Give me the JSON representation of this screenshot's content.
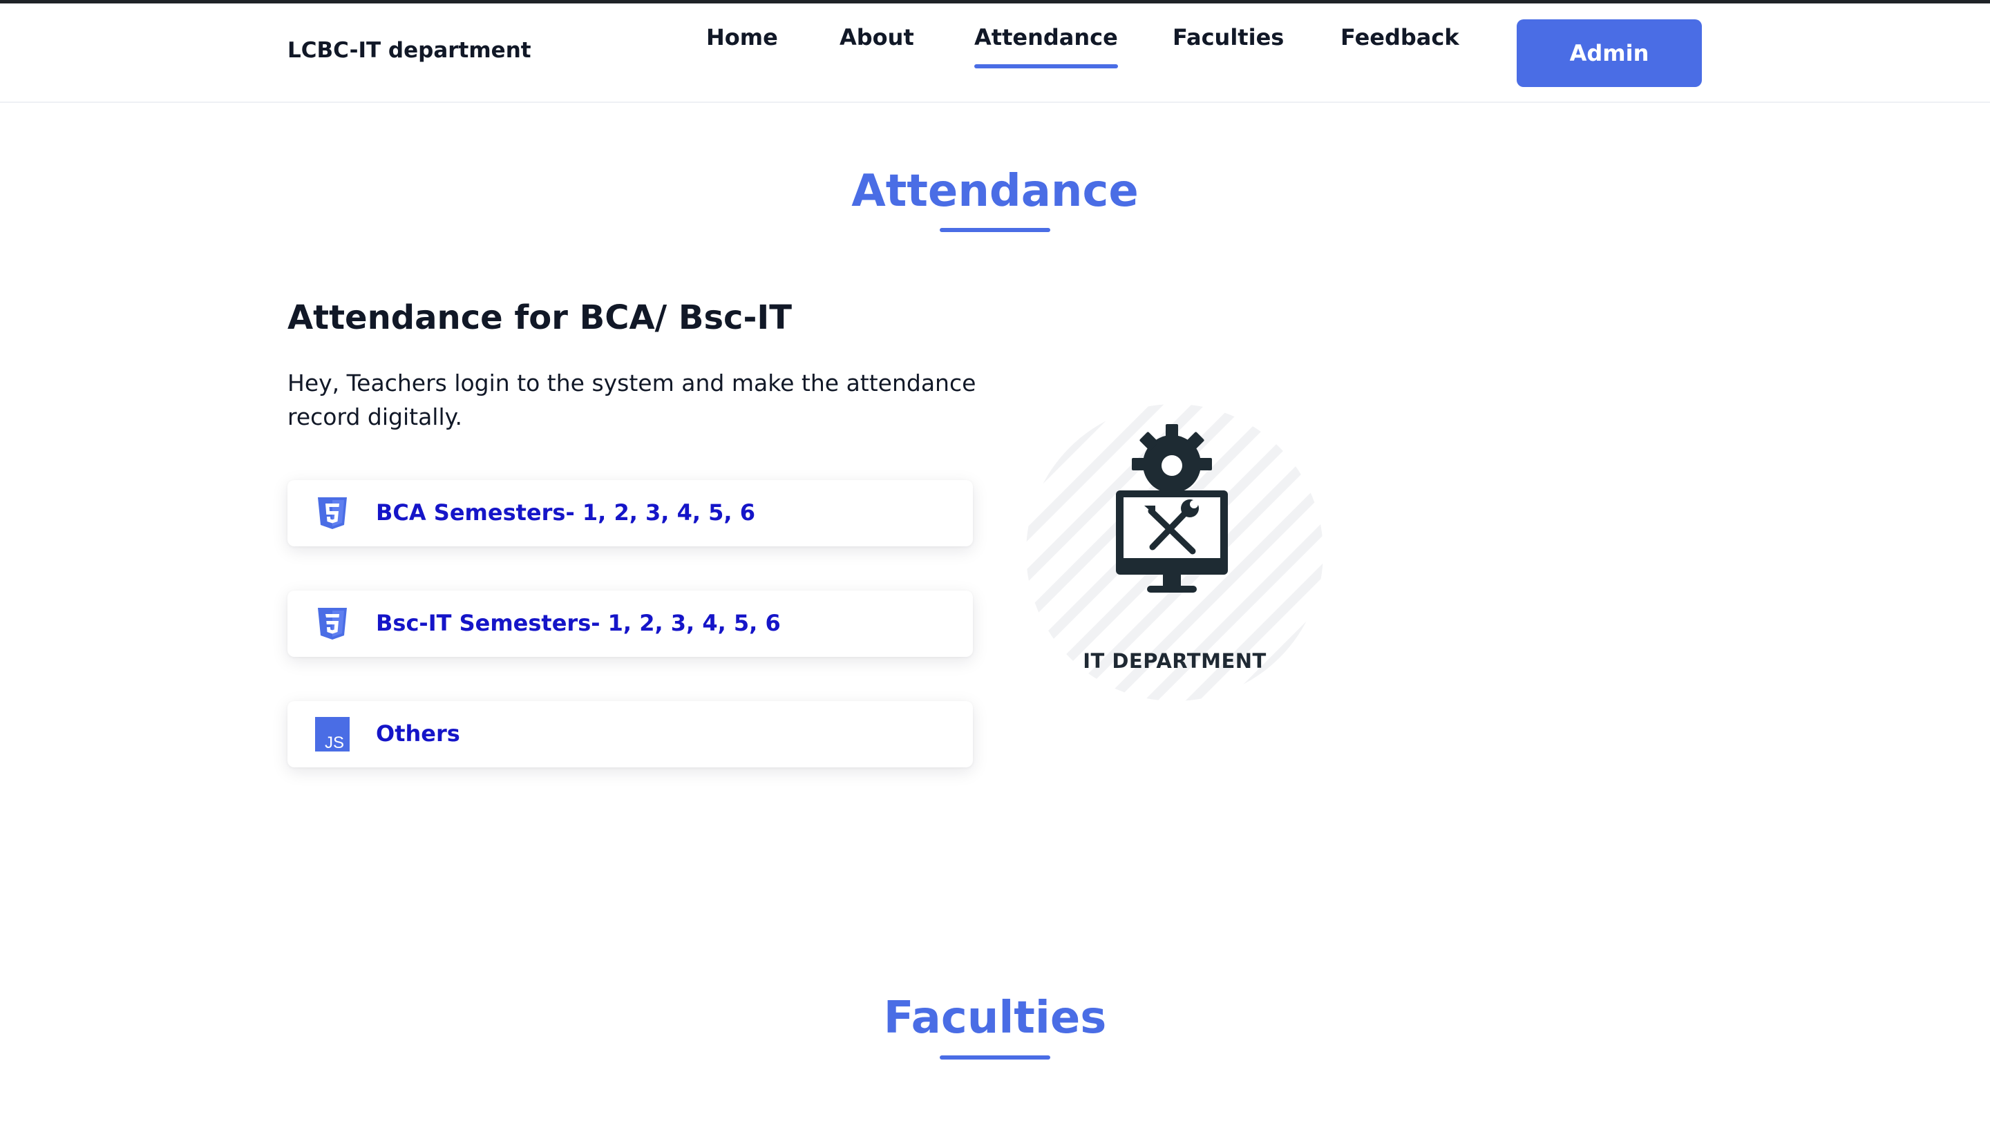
{
  "header": {
    "brand": "LCBC-IT department",
    "nav": [
      "Home",
      "About",
      "Attendance",
      "Faculties",
      "Feedback"
    ],
    "active_nav": "Attendance",
    "admin_label": "Admin"
  },
  "attendance": {
    "title": "Attendance",
    "heading": "Attendance for BCA/ Bsc-IT",
    "intro": "Hey, Teachers login to the system and make the attendance record digitally.",
    "cards": [
      {
        "label": "BCA Semesters- 1, 2, 3, 4, 5, 6",
        "icon": "html5-icon"
      },
      {
        "label": "Bsc-IT Semesters- 1, 2, 3, 4, 5, 6",
        "icon": "css3-icon"
      },
      {
        "label": "Others",
        "icon": "js-icon",
        "icon_text": "JS"
      }
    ],
    "illustration_label": "IT DEPARTMENT"
  },
  "faculties": {
    "title": "Faculties"
  },
  "colors": {
    "accent": "#4a6de5",
    "link": "#1515c8",
    "text": "#111827"
  }
}
